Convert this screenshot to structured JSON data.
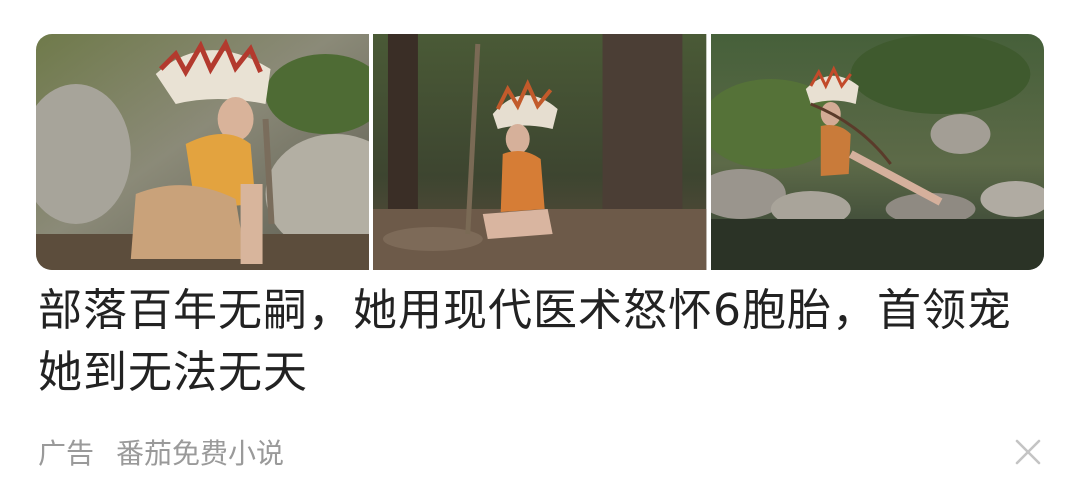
{
  "ad": {
    "headline": "部落百年无嗣，她用现代医术怒怀6胞胎，首领宠她到无法无天",
    "ad_label": "广告",
    "source": "番茄免费小说"
  },
  "icons": {
    "close": "close-icon"
  },
  "colors": {
    "headline": "#222222",
    "meta": "#9a9a9a",
    "close": "#c4c4c4"
  }
}
